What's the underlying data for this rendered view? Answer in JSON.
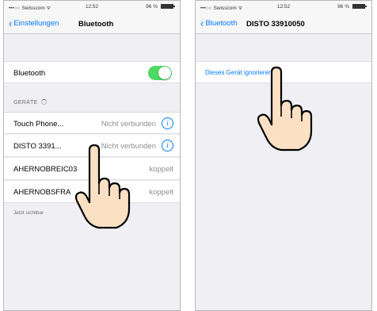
{
  "left": {
    "status": {
      "carrier": "•••○○ Swisscom ᯤ",
      "time": "12:52",
      "battery_pct": "96 %"
    },
    "nav": {
      "back": "Einstellungen",
      "title": "Bluetooth"
    },
    "bluetooth_label": "Bluetooth",
    "bluetooth_on": true,
    "section_devices": "GERÄTE",
    "devices": [
      {
        "name": "Touch Phone...",
        "status": "Nicht verbunden",
        "info": true
      },
      {
        "name": "DISTO 3391...",
        "status": "Nicht verbunden",
        "info": true
      },
      {
        "name": "AHERNOBREIC03",
        "status": "koppelt",
        "info": false
      },
      {
        "name": "AHERNOBSFRA",
        "status": "koppelt",
        "info": false
      }
    ],
    "visible_note": "Jetzt sichtbar"
  },
  "right": {
    "status": {
      "carrier": "•••○○ Swisscom ᯤ",
      "time": "12:52",
      "battery_pct": "96 %"
    },
    "nav": {
      "back": "Bluetooth",
      "title": "DISTO 33910050"
    },
    "ignore_link": "Dieses Gerät ignorieren"
  },
  "colors": {
    "accent": "#007aff",
    "toggle_on": "#4cd964",
    "background": "#efeff4"
  },
  "icons": {
    "back": "chevron-left-icon",
    "info": "info-icon",
    "pointer": "pointing-hand-icon"
  }
}
